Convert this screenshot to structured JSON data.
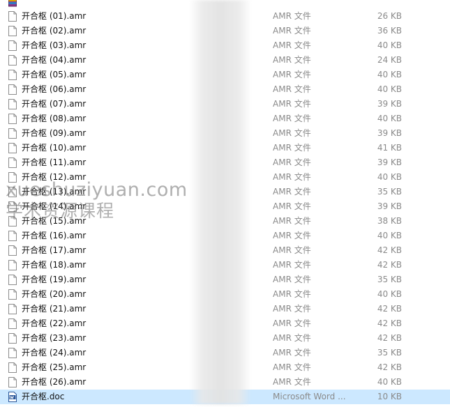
{
  "colors": {
    "selected_row_bg": "#cce8ff",
    "muted_text": "#8a8a8a",
    "doc_icon_blue": "#2b579a"
  },
  "icons": {
    "audio_file": "blank-document-icon",
    "word_file": "word-document-icon",
    "archive_file": "winrar-archive-icon"
  },
  "watermark": {
    "line1": "xueshuziyuan.com",
    "line2": "学术资源课程"
  },
  "files": [
    {
      "name": "开合枢 (01).amr",
      "type": "AMR 文件",
      "size": "26 KB"
    },
    {
      "name": "开合枢 (02).amr",
      "type": "AMR 文件",
      "size": "36 KB"
    },
    {
      "name": "开合枢 (03).amr",
      "type": "AMR 文件",
      "size": "40 KB"
    },
    {
      "name": "开合枢 (04).amr",
      "type": "AMR 文件",
      "size": "24 KB"
    },
    {
      "name": "开合枢 (05).amr",
      "type": "AMR 文件",
      "size": "40 KB"
    },
    {
      "name": "开合枢 (06).amr",
      "type": "AMR 文件",
      "size": "40 KB"
    },
    {
      "name": "开合枢 (07).amr",
      "type": "AMR 文件",
      "size": "39 KB"
    },
    {
      "name": "开合枢 (08).amr",
      "type": "AMR 文件",
      "size": "40 KB"
    },
    {
      "name": "开合枢 (09).amr",
      "type": "AMR 文件",
      "size": "39 KB"
    },
    {
      "name": "开合枢 (10).amr",
      "type": "AMR 文件",
      "size": "41 KB"
    },
    {
      "name": "开合枢 (11).amr",
      "type": "AMR 文件",
      "size": "39 KB"
    },
    {
      "name": "开合枢 (12).amr",
      "type": "AMR 文件",
      "size": "40 KB"
    },
    {
      "name": "开合枢 (13).amr",
      "type": "AMR 文件",
      "size": "35 KB"
    },
    {
      "name": "开合枢 (14).amr",
      "type": "AMR 文件",
      "size": "39 KB"
    },
    {
      "name": "开合枢 (15).amr",
      "type": "AMR 文件",
      "size": "38 KB"
    },
    {
      "name": "开合枢 (16).amr",
      "type": "AMR 文件",
      "size": "40 KB"
    },
    {
      "name": "开合枢 (17).amr",
      "type": "AMR 文件",
      "size": "42 KB"
    },
    {
      "name": "开合枢 (18).amr",
      "type": "AMR 文件",
      "size": "42 KB"
    },
    {
      "name": "开合枢 (19).amr",
      "type": "AMR 文件",
      "size": "35 KB"
    },
    {
      "name": "开合枢 (20).amr",
      "type": "AMR 文件",
      "size": "40 KB"
    },
    {
      "name": "开合枢 (21).amr",
      "type": "AMR 文件",
      "size": "42 KB"
    },
    {
      "name": "开合枢 (22).amr",
      "type": "AMR 文件",
      "size": "42 KB"
    },
    {
      "name": "开合枢 (23).amr",
      "type": "AMR 文件",
      "size": "42 KB"
    },
    {
      "name": "开合枢 (24).amr",
      "type": "AMR 文件",
      "size": "35 KB"
    },
    {
      "name": "开合枢 (25).amr",
      "type": "AMR 文件",
      "size": "42 KB"
    },
    {
      "name": "开合枢 (26).amr",
      "type": "AMR 文件",
      "size": "40 KB"
    },
    {
      "name": "开合枢.doc",
      "type": "Microsoft Word ...",
      "size": "10 KB"
    }
  ]
}
